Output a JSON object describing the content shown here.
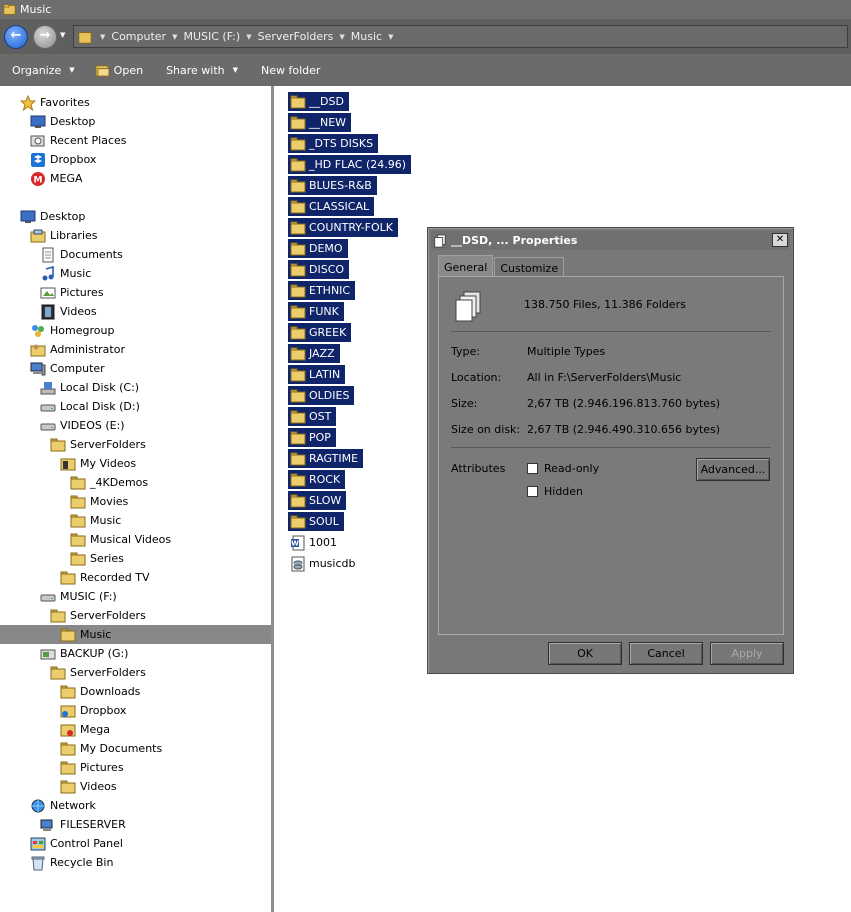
{
  "window": {
    "title": "Music"
  },
  "address": {
    "crumbs": [
      "Computer",
      "MUSIC (F:)",
      "ServerFolders",
      "Music"
    ]
  },
  "toolbar": {
    "organize": "Organize",
    "open": "Open",
    "share_with": "Share with",
    "new_folder": "New folder"
  },
  "nav": {
    "items": [
      {
        "label": "Favorites",
        "icon": "star-icon"
      },
      {
        "label": "Desktop",
        "icon": "desktop-icon"
      },
      {
        "label": "Recent Places",
        "icon": "recent-places-icon"
      },
      {
        "label": "Dropbox",
        "icon": "dropbox-icon"
      },
      {
        "label": "MEGA",
        "icon": "mega-icon"
      },
      {
        "label": "Desktop",
        "icon": "desktop-icon"
      },
      {
        "label": "Libraries",
        "icon": "libraries-icon"
      },
      {
        "label": "Documents",
        "icon": "documents-icon"
      },
      {
        "label": "Music",
        "icon": "music-note-icon"
      },
      {
        "label": "Pictures",
        "icon": "pictures-icon"
      },
      {
        "label": "Videos",
        "icon": "videos-icon"
      },
      {
        "label": "Homegroup",
        "icon": "homegroup-icon"
      },
      {
        "label": "Administrator",
        "icon": "user-folder-icon"
      },
      {
        "label": "Computer",
        "icon": "computer-icon"
      },
      {
        "label": "Local Disk (C:)",
        "icon": "system-drive-icon"
      },
      {
        "label": "Local Disk (D:)",
        "icon": "drive-icon"
      },
      {
        "label": "VIDEOS (E:)",
        "icon": "drive-icon"
      },
      {
        "label": "ServerFolders",
        "icon": "folder-icon"
      },
      {
        "label": "My Videos",
        "icon": "videos-folder-icon"
      },
      {
        "label": "_4KDemos",
        "icon": "folder-icon"
      },
      {
        "label": "Movies",
        "icon": "folder-icon"
      },
      {
        "label": "Music",
        "icon": "folder-icon"
      },
      {
        "label": "Musical Videos",
        "icon": "folder-icon"
      },
      {
        "label": "Series",
        "icon": "folder-icon"
      },
      {
        "label": "Recorded TV",
        "icon": "folder-icon"
      },
      {
        "label": "MUSIC (F:)",
        "icon": "drive-icon"
      },
      {
        "label": "ServerFolders",
        "icon": "folder-icon"
      },
      {
        "label": "Music",
        "icon": "folder-icon"
      },
      {
        "label": "BACKUP (G:)",
        "icon": "backup-drive-icon"
      },
      {
        "label": "ServerFolders",
        "icon": "folder-icon"
      },
      {
        "label": "Downloads",
        "icon": "folder-icon"
      },
      {
        "label": "Dropbox",
        "icon": "dropbox-folder-icon"
      },
      {
        "label": "Mega",
        "icon": "mega-folder-icon"
      },
      {
        "label": "My Documents",
        "icon": "folder-icon"
      },
      {
        "label": "Pictures",
        "icon": "folder-icon"
      },
      {
        "label": "Videos",
        "icon": "folder-icon"
      },
      {
        "label": "Network",
        "icon": "network-icon"
      },
      {
        "label": "FILESERVER",
        "icon": "server-icon"
      },
      {
        "label": "Control Panel",
        "icon": "control-panel-icon"
      },
      {
        "label": "Recycle Bin",
        "icon": "recycle-bin-icon"
      }
    ]
  },
  "files": [
    {
      "name": "__DSD",
      "type": "folder"
    },
    {
      "name": "__NEW",
      "type": "folder"
    },
    {
      "name": "_DTS DISKS",
      "type": "folder"
    },
    {
      "name": "_HD FLAC (24.96)",
      "type": "folder"
    },
    {
      "name": "BLUES-R&B",
      "type": "folder"
    },
    {
      "name": "CLASSICAL",
      "type": "folder"
    },
    {
      "name": "COUNTRY-FOLK",
      "type": "folder"
    },
    {
      "name": "DEMO",
      "type": "folder"
    },
    {
      "name": "DISCO",
      "type": "folder"
    },
    {
      "name": "ETHNIC",
      "type": "folder"
    },
    {
      "name": "FUNK",
      "type": "folder"
    },
    {
      "name": "GREEK",
      "type": "folder"
    },
    {
      "name": "JAZZ",
      "type": "folder"
    },
    {
      "name": "LATIN",
      "type": "folder"
    },
    {
      "name": "OLDIES",
      "type": "folder"
    },
    {
      "name": "OST",
      "type": "folder"
    },
    {
      "name": "POP",
      "type": "folder"
    },
    {
      "name": "RAGTIME",
      "type": "folder"
    },
    {
      "name": "ROCK",
      "type": "folder"
    },
    {
      "name": "SLOW",
      "type": "folder"
    },
    {
      "name": "SOUL",
      "type": "folder"
    },
    {
      "name": "1001",
      "type": "word-doc"
    },
    {
      "name": "musicdb",
      "type": "database"
    }
  ],
  "properties": {
    "title": "__DSD, ... Properties",
    "tabs": [
      "General",
      "Customize"
    ],
    "summary": "138.750 Files, 11.386 Folders",
    "type_label": "Type:",
    "type_value": "Multiple Types",
    "location_label": "Location:",
    "location_value": "All in F:\\ServerFolders\\Music",
    "size_label": "Size:",
    "size_value": "2,67 TB (2.946.196.813.760 bytes)",
    "size_on_disk_label": "Size on disk:",
    "size_on_disk_value": "2,67 TB (2.946.490.310.656 bytes)",
    "attributes_label": "Attributes",
    "readonly_label": "Read-only",
    "hidden_label": "Hidden",
    "advanced_label": "Advanced...",
    "ok_label": "OK",
    "cancel_label": "Cancel",
    "apply_label": "Apply"
  }
}
